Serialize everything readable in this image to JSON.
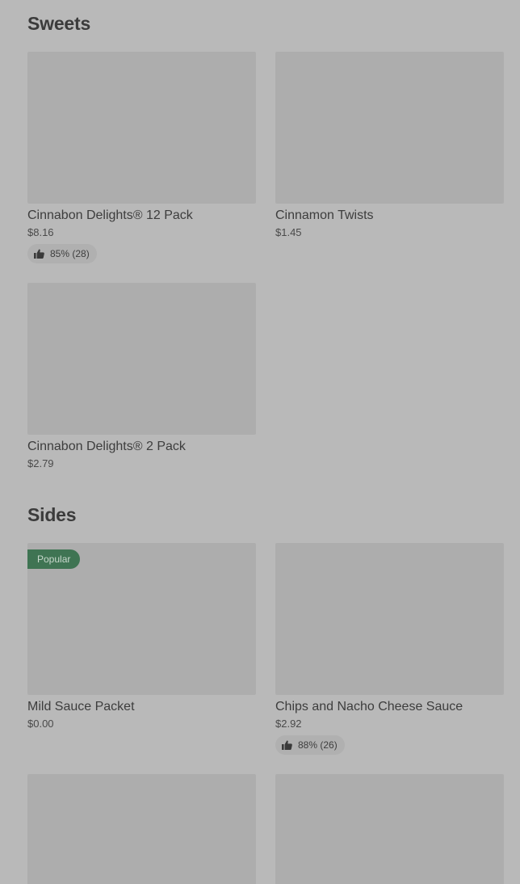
{
  "sections": [
    {
      "title": "Sweets",
      "items": [
        {
          "name": "Cinnabon Delights® 12 Pack",
          "price": "$8.16",
          "rating": "85% (28)"
        },
        {
          "name": "Cinnamon Twists",
          "price": "$1.45"
        },
        {
          "name": "Cinnabon Delights® 2 Pack",
          "price": "$2.79"
        }
      ]
    },
    {
      "title": "Sides",
      "items": [
        {
          "name": "Mild Sauce Packet",
          "price": "$0.00",
          "badge": "Popular"
        },
        {
          "name": "Chips and Nacho Cheese Sauce",
          "price": "$2.92",
          "rating": "88% (26)"
        }
      ]
    }
  ],
  "icons": {
    "rating": "thumbs-up-icon"
  },
  "colors": {
    "background": "#b9b9b9",
    "image_placeholder": "#adadad",
    "popular_badge": "#3f7453",
    "rating_pill": "#b0b0b0"
  }
}
